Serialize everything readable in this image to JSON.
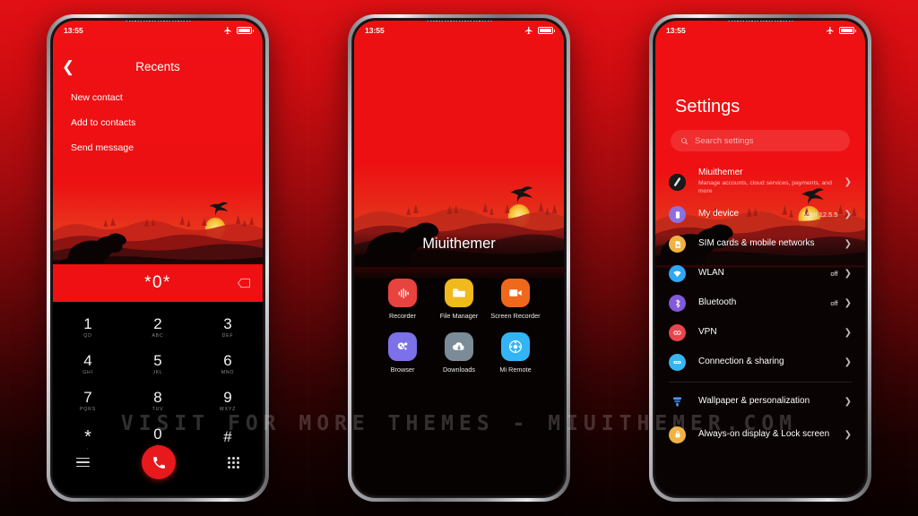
{
  "theme": {
    "accent_red": "#ee1013",
    "dark": "#070202",
    "background_gradient_top": "#e21014",
    "background_gradient_bottom": "#0a0101"
  },
  "watermark": {
    "text": "VISIT  FOR  MORE  THEMES  -  MIUITHEMER.COM"
  },
  "status_bar": {
    "time": "13:55",
    "airplane_icon": "airplane-mode-icon",
    "battery_icon": "battery-full-icon"
  },
  "phone1": {
    "name": "dialer-phone",
    "nav": {
      "back_icon": "chevron-left-icon",
      "title": "Recents"
    },
    "menu_items": [
      {
        "label": "New contact"
      },
      {
        "label": "Add to contacts"
      },
      {
        "label": "Send message"
      }
    ],
    "dial_input": {
      "value": "*0*",
      "delete_icon": "backspace-icon"
    },
    "keypad": [
      [
        {
          "digit": "1",
          "letters": "QD"
        },
        {
          "digit": "2",
          "letters": "ABC"
        },
        {
          "digit": "3",
          "letters": "DEF"
        }
      ],
      [
        {
          "digit": "4",
          "letters": "GHI"
        },
        {
          "digit": "5",
          "letters": "JKL"
        },
        {
          "digit": "6",
          "letters": "MNO"
        }
      ],
      [
        {
          "digit": "7",
          "letters": "PQRS"
        },
        {
          "digit": "8",
          "letters": "TUV"
        },
        {
          "digit": "9",
          "letters": "WXYZ"
        }
      ],
      [
        {
          "digit": "*",
          "letters": ","
        },
        {
          "digit": "0",
          "letters": "+"
        },
        {
          "digit": "#",
          "letters": ""
        }
      ]
    ],
    "actions": {
      "menu_icon": "hamburger-menu-icon",
      "call_icon": "phone-call-icon",
      "keypad_icon": "dialpad-grid-icon"
    }
  },
  "phone2": {
    "name": "home-screen-phone",
    "wallpaper_label": "Miuithemer",
    "apps": [
      [
        {
          "label": "Recorder",
          "icon": "recorder-icon",
          "color": "#e8433f"
        },
        {
          "label": "File Manager",
          "icon": "folder-icon",
          "color": "#f0b91c"
        },
        {
          "label": "Screen Recorder",
          "icon": "video-camera-icon",
          "color": "#f0681c"
        }
      ],
      [
        {
          "label": "Browser",
          "icon": "browser-icon",
          "color": "#7c71e8"
        },
        {
          "label": "Downloads",
          "icon": "cloud-download-icon",
          "color": "#7b8b98"
        },
        {
          "label": "Mi Remote",
          "icon": "remote-control-icon",
          "color": "#33b5f5"
        }
      ]
    ]
  },
  "phone3": {
    "name": "settings-phone",
    "title": "Settings",
    "search": {
      "placeholder": "Search settings",
      "icon": "search-icon"
    },
    "items": [
      {
        "label": "Miuithemer",
        "sub": "Manage accounts, cloud services, payments, and more",
        "value": "",
        "icon": "account-avatar-icon",
        "color": "#141414",
        "tall": true
      },
      {
        "label": "My device",
        "sub": "",
        "value": "MIUI 12.5.5",
        "icon": "device-icon",
        "color": "#8e6fe0",
        "tall": false
      },
      {
        "label": "SIM cards & mobile networks",
        "sub": "",
        "value": "",
        "icon": "sim-card-icon",
        "color": "#f0b243",
        "tall": false
      },
      {
        "label": "WLAN",
        "sub": "",
        "value": "off",
        "icon": "wifi-icon",
        "color": "#2fa8f5",
        "tall": false
      },
      {
        "label": "Bluetooth",
        "sub": "",
        "value": "off",
        "icon": "bluetooth-icon",
        "color": "#8259d8",
        "tall": false
      },
      {
        "label": "VPN",
        "sub": "",
        "value": "",
        "icon": "vpn-icon",
        "color": "#e8454f",
        "tall": false
      },
      {
        "label": "Connection & sharing",
        "sub": "",
        "value": "",
        "icon": "connection-sharing-icon",
        "color": "#35b6f2",
        "tall": false
      }
    ],
    "items2": [
      {
        "label": "Wallpaper & personalization",
        "sub": "",
        "value": "",
        "icon": "wallpaper-icon",
        "color": "#3c8fe0",
        "tall": false
      },
      {
        "label": "Always-on display & Lock screen",
        "sub": "",
        "value": "",
        "icon": "lock-icon",
        "color": "#f0b243",
        "tall": true
      }
    ]
  }
}
